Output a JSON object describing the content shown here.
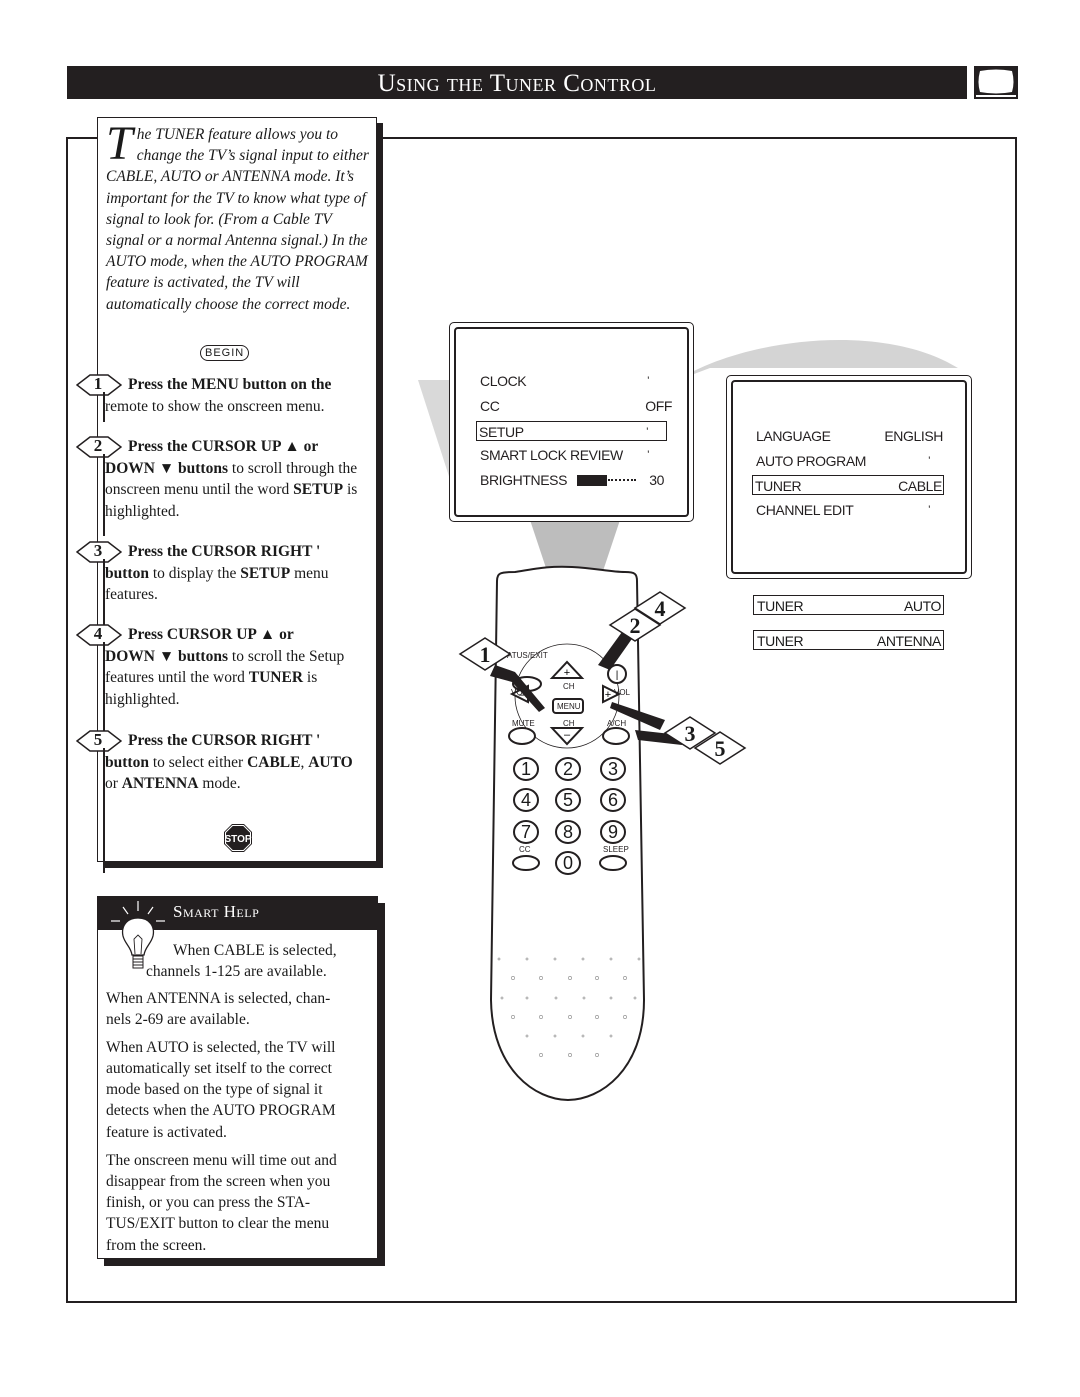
{
  "header": {
    "title": "Using the Tuner Control",
    "icon": "tv-icon"
  },
  "intro": {
    "dropcap": "T",
    "text": "he TUNER feature allows you to change the TV’s signal input to either CABLE, AUTO or ANTENNA mode. It’s important for the TV to know what type of signal to look for. (From a Cable TV signal or a normal Antenna signal.) In the AUTO mode, when the AUTO PROGRAM feature is activated, the TV will automatically choose the correct mode.",
    "begin_label": "BEGIN"
  },
  "steps": [
    {
      "num": "1",
      "line1_bold": "Press the MENU button",
      "line1_rest": " on the",
      "body": "remote to show the onscreen menu."
    },
    {
      "num": "2",
      "line1_bold": "Press the CURSOR UP ▲ or",
      "line1_rest": "",
      "body_bold": "DOWN ▼ buttons",
      "body": " to scroll through the onscreen menu until the word ",
      "body_bold2": "SETUP",
      "body2": " is highlighted."
    },
    {
      "num": "3",
      "line1_bold": "Press the CURSOR RIGHT '",
      "line1_rest": "",
      "body_bold": "button",
      "body": " to display the ",
      "body_bold2": "SETUP",
      "body2": " menu features."
    },
    {
      "num": "4",
      "line1_bold": "Press CURSOR UP ▲ or",
      "line1_rest": "",
      "body_bold": "DOWN ▼ buttons",
      "body": " to scroll the Setup features until the word ",
      "body_bold2": "TUNER",
      "body2": " is highlighted."
    },
    {
      "num": "5",
      "line1_bold": "Press the CURSOR RIGHT '",
      "line1_rest": "",
      "body_bold": "button",
      "body": " to select either ",
      "body_bold2": "CABLE",
      "body2": ", ",
      "body_bold3": "AUTO",
      "body3": " or ",
      "body_bold4": "ANTENNA",
      "body4": " mode."
    }
  ],
  "stop_label": "STOP",
  "smart_help": {
    "title": "Smart Help",
    "paragraphs": [
      "When CABLE is selected,",
      "channels 1-125 are available.",
      "When ANTENNA is selected, chan-",
      "nels 2-69 are available.",
      "When AUTO is selected, the TV will",
      "automatically set itself to the correct",
      "mode based on the type of signal it",
      "detects when the AUTO PROGRAM",
      "feature is activated.",
      "The onscreen menu will time out and",
      "disappear from the screen when you",
      "finish, or you can press the STA-",
      "TUS/EXIT button to clear the menu",
      "from the screen."
    ]
  },
  "main_menu": {
    "items": [
      {
        "label": "CLOCK",
        "value": "'"
      },
      {
        "label": "CC",
        "value": "OFF"
      },
      {
        "label": "SETUP",
        "value": "'",
        "highlighted": true
      },
      {
        "label": "SMART LOCK REVIEW",
        "value": "'"
      },
      {
        "label": "BRIGHTNESS",
        "value": "30",
        "level": 0.5
      }
    ]
  },
  "setup_menu": {
    "items": [
      {
        "label": "LANGUAGE",
        "value": "ENGLISH"
      },
      {
        "label": "AUTO PROGRAM",
        "value": "'"
      },
      {
        "label": "TUNER",
        "value": "CABLE",
        "highlighted": true
      },
      {
        "label": "CHANNEL EDIT",
        "value": "'"
      }
    ]
  },
  "tuner_options": [
    {
      "label": "TUNER",
      "value": "AUTO"
    },
    {
      "label": "TUNER",
      "value": "ANTENNA"
    }
  ],
  "remote": {
    "labels": {
      "status_exit": "ATUS/EXIT",
      "ch_up": "CH",
      "vol_left": "VO",
      "vol_right": "VOL",
      "menu": "MENU",
      "mute": "MUTE",
      "ch_down": "CH",
      "ach": "A/CH",
      "cc": "CC",
      "sleep": "SLEEP"
    },
    "keys": [
      "1",
      "2",
      "3",
      "4",
      "5",
      "6",
      "7",
      "8",
      "9",
      "0"
    ],
    "step_markers": [
      "1",
      "2",
      "4",
      "3",
      "5"
    ]
  }
}
